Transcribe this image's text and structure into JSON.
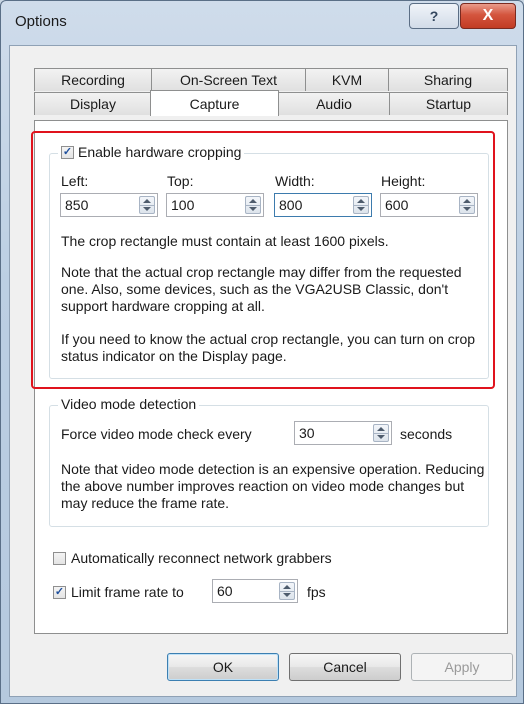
{
  "window": {
    "title": "Options",
    "help_glyph": "?",
    "close_glyph": "X"
  },
  "tabs": {
    "row1": [
      "Recording",
      "On-Screen Text",
      "KVM",
      "Sharing"
    ],
    "row2": [
      "Display",
      "Capture",
      "Audio",
      "Startup"
    ],
    "active": "Capture"
  },
  "cropping": {
    "enable_label": "Enable hardware cropping",
    "enabled": true,
    "fields": [
      {
        "label": "Left:",
        "value": "850"
      },
      {
        "label": "Top:",
        "value": "100"
      },
      {
        "label": "Width:",
        "value": "800"
      },
      {
        "label": "Height:",
        "value": "600"
      }
    ],
    "note1": "The crop rectangle must contain at least 1600 pixels.",
    "note2": "Note that the actual crop rectangle may differ from the requested one. Also, some devices, such as the VGA2USB Classic, don't support hardware cropping at all.",
    "note3": "If you need to know the actual crop rectangle, you can turn on crop status indicator on the Display page."
  },
  "video_mode": {
    "group_label": "Video mode detection",
    "force_label": "Force video mode check every",
    "value": "30",
    "unit": "seconds",
    "note": "Note that video mode detection is an expensive operation. Reducing the above number improves reaction on video mode changes but may reduce the frame rate."
  },
  "reconnect": {
    "label": "Automatically reconnect network grabbers",
    "checked": false
  },
  "frame_rate": {
    "label": "Limit frame rate to",
    "checked": true,
    "value": "60",
    "unit": "fps"
  },
  "buttons": {
    "ok": "OK",
    "cancel": "Cancel",
    "apply": "Apply"
  }
}
